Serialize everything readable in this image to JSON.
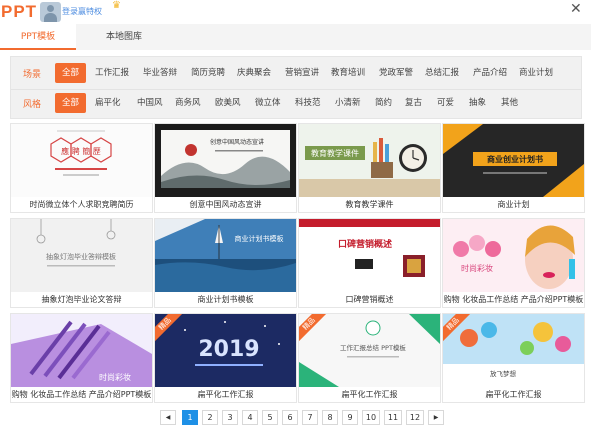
{
  "window": {
    "logo_text": "PPT",
    "login_label": "登录赢特权",
    "close_glyph": "✕",
    "crown_glyph": "♛"
  },
  "tabs": [
    {
      "label": "PPT模板",
      "active": true
    },
    {
      "label": "本地图库",
      "active": false
    }
  ],
  "filters": {
    "scene": {
      "label": "场景",
      "options": [
        "全部",
        "工作汇报",
        "毕业答辩",
        "简历竞聘",
        "庆典聚会",
        "营销宣讲",
        "教育培训",
        "党政军警",
        "总结汇报",
        "产品介绍",
        "商业计划"
      ],
      "selected": "全部"
    },
    "style": {
      "label": "风格",
      "options": [
        "全部",
        "扁平化",
        "中国风",
        "商务风",
        "欧美风",
        "微立体",
        "科技范",
        "小清新",
        "简约",
        "复古",
        "可爱",
        "抽象",
        "其他"
      ],
      "selected": "全部"
    }
  },
  "templates": [
    {
      "caption": "时尚微立体个人求职竞聘简历",
      "thumb_text": "應 聘 簡 歷",
      "premium": false
    },
    {
      "caption": "创意中国风动态宣讲",
      "thumb_text": "创意中国风动态宣讲",
      "premium": false
    },
    {
      "caption": "教育教学课件",
      "thumb_text": "教育教学课件",
      "premium": false
    },
    {
      "caption": "商业计划",
      "thumb_text": "商业创业计划书",
      "premium": false
    },
    {
      "caption": "抽象灯泡毕业论文答辩",
      "thumb_text": "抽象灯泡毕业答辩模板",
      "premium": false
    },
    {
      "caption": "商业计划书模板",
      "thumb_text": "商业计划书模板",
      "premium": false
    },
    {
      "caption": "口碑营销概述",
      "thumb_text": "口碑营销概述",
      "premium": false
    },
    {
      "caption": "购物 化妆品工作总结 产品介绍PPT模板",
      "thumb_text": "时尚彩妆",
      "premium": false
    },
    {
      "caption": "购物 化妆品工作总结 产品介绍PPT模板",
      "thumb_text": "时尚彩妆",
      "premium": false
    },
    {
      "caption": "扁平化工作汇报",
      "thumb_text": "2019",
      "premium": true,
      "tag": "精品"
    },
    {
      "caption": "扁平化工作汇报",
      "thumb_text": "工作汇报总结 PPT模板",
      "premium": true,
      "tag": "精品"
    },
    {
      "caption": "扁平化工作汇报",
      "thumb_text": "放飞梦想",
      "premium": true,
      "tag": "精品"
    }
  ],
  "pagination": {
    "prev": "◀",
    "next": "▶",
    "pages": [
      "1",
      "2",
      "3",
      "4",
      "5",
      "6",
      "7",
      "8",
      "9",
      "10",
      "11",
      "12"
    ],
    "current": "1"
  },
  "colors": {
    "accent": "#f26b2f",
    "pager_active": "#1e90e6",
    "link": "#4c8ce0"
  }
}
